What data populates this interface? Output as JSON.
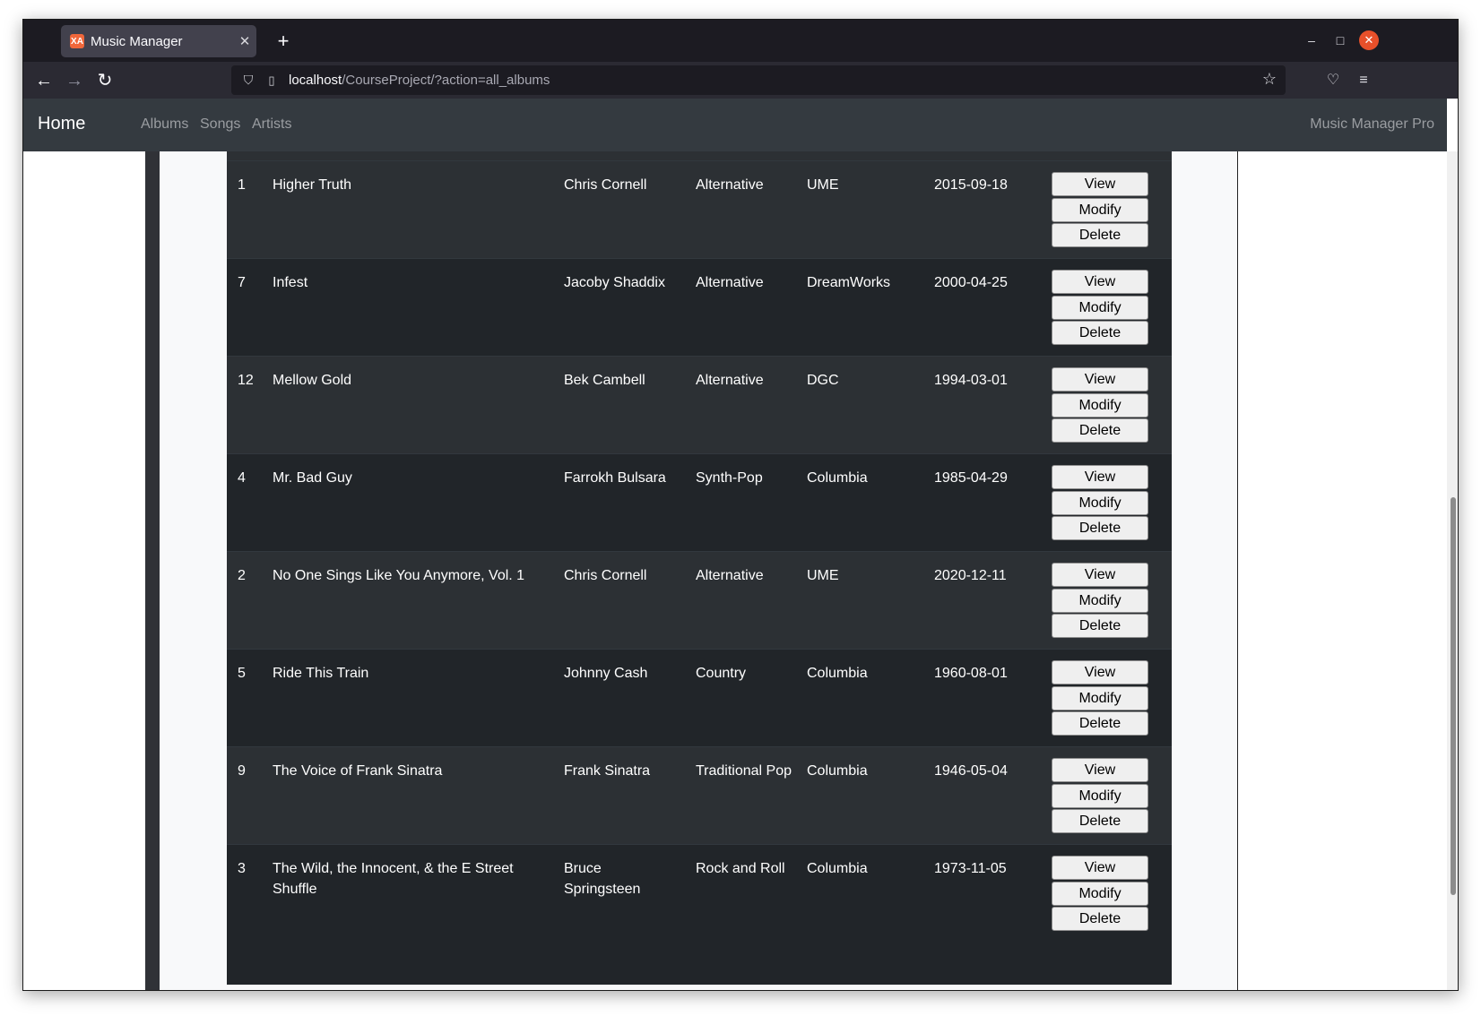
{
  "browser": {
    "tab_title": "Music Manager",
    "tab_favicon": "XA",
    "url_host": "localhost",
    "url_path": "/CourseProject/?action=all_albums"
  },
  "site": {
    "brand": "Home",
    "nav": [
      "Albums",
      "Songs",
      "Artists"
    ],
    "right_text": "Music Manager Pro"
  },
  "buttons": {
    "view": "View",
    "modify": "Modify",
    "delete": "Delete"
  },
  "albums": [
    {
      "id": "1",
      "title": "Higher Truth",
      "artist": "Chris Cornell",
      "genre": "Alternative",
      "label": "UME",
      "date": "2015-09-18"
    },
    {
      "id": "7",
      "title": "Infest",
      "artist": "Jacoby Shaddix",
      "genre": "Alternative",
      "label": "DreamWorks",
      "date": "2000-04-25"
    },
    {
      "id": "12",
      "title": "Mellow Gold",
      "artist": "Bek Cambell",
      "genre": "Alternative",
      "label": "DGC",
      "date": "1994-03-01"
    },
    {
      "id": "4",
      "title": "Mr. Bad Guy",
      "artist": "Farrokh Bulsara",
      "genre": "Synth-Pop",
      "label": "Columbia",
      "date": "1985-04-29"
    },
    {
      "id": "2",
      "title": "No One Sings Like You Anymore, Vol. 1",
      "artist": "Chris Cornell",
      "genre": "Alternative",
      "label": "UME",
      "date": "2020-12-11"
    },
    {
      "id": "5",
      "title": "Ride This Train",
      "artist": "Johnny Cash",
      "genre": "Country",
      "label": "Columbia",
      "date": "1960-08-01"
    },
    {
      "id": "9",
      "title": "The Voice of Frank Sinatra",
      "artist": "Frank Sinatra",
      "genre": "Traditional Pop",
      "label": "Columbia",
      "date": "1946-05-04"
    },
    {
      "id": "3",
      "title": "The Wild, the Innocent, & the E Street Shuffle",
      "artist": "Bruce Springsteen",
      "genre": "Rock and Roll",
      "label": "Columbia",
      "date": "1973-11-05"
    }
  ]
}
